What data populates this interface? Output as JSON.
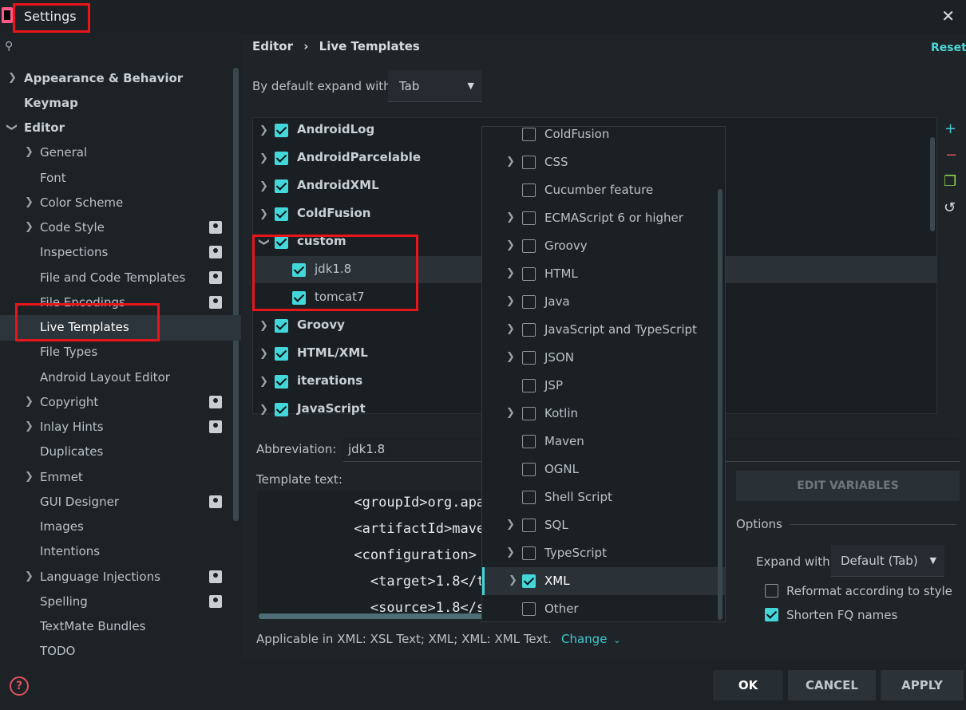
{
  "window": {
    "title": "Settings"
  },
  "sidebar": {
    "items": [
      {
        "label": "Appearance & Behavior"
      },
      {
        "label": "Keymap"
      },
      {
        "label": "Editor"
      },
      {
        "label": "General"
      },
      {
        "label": "Font"
      },
      {
        "label": "Color Scheme"
      },
      {
        "label": "Code Style"
      },
      {
        "label": "Inspections"
      },
      {
        "label": "File and Code Templates"
      },
      {
        "label": "File Encodings"
      },
      {
        "label": "Live Templates"
      },
      {
        "label": "File Types"
      },
      {
        "label": "Android Layout Editor"
      },
      {
        "label": "Copyright"
      },
      {
        "label": "Inlay Hints"
      },
      {
        "label": "Duplicates"
      },
      {
        "label": "Emmet"
      },
      {
        "label": "GUI Designer"
      },
      {
        "label": "Images"
      },
      {
        "label": "Intentions"
      },
      {
        "label": "Language Injections"
      },
      {
        "label": "Spelling"
      },
      {
        "label": "TextMate Bundles"
      },
      {
        "label": "TODO"
      }
    ]
  },
  "breadcrumb": {
    "parent": "Editor",
    "separator": "›",
    "current": "Live Templates"
  },
  "reset_label": "Reset",
  "expand_default": {
    "label": "By default expand with",
    "value": "Tab"
  },
  "template_groups": [
    {
      "label": "AndroidLog",
      "checked": true
    },
    {
      "label": "AndroidParcelable",
      "checked": true
    },
    {
      "label": "AndroidXML",
      "checked": true
    },
    {
      "label": "ColdFusion",
      "checked": true
    },
    {
      "label": "custom",
      "checked": true,
      "expanded": true
    },
    {
      "label": "jdk1.8",
      "checked": true,
      "child": true
    },
    {
      "label": "tomcat7",
      "checked": true,
      "child": true
    },
    {
      "label": "Groovy",
      "checked": true
    },
    {
      "label": "HTML/XML",
      "checked": true
    },
    {
      "label": "iterations",
      "checked": true
    },
    {
      "label": "JavaScript",
      "checked": true
    }
  ],
  "form": {
    "abbreviation_label": "Abbreviation:",
    "abbreviation_value": "jdk1.8",
    "template_text_label": "Template text:",
    "code_lines": [
      "      <groupId>org.apa",
      "      <artifactId>mave",
      "      <configuration>",
      "        <target>1.8</t",
      "        <source>1.8</s"
    ],
    "edit_variables": "EDIT VARIABLES",
    "options_label": "Options",
    "expand_with_label": "Expand with",
    "expand_with_value": "Default (Tab)",
    "reformat_label": "Reformat according to style",
    "reformat_checked": false,
    "shorten_label": "Shorten FQ names",
    "shorten_checked": true,
    "applicable_text": "Applicable in XML: XSL Text; XML; XML: XML Text.",
    "change_label": "Change"
  },
  "context_dropdown": [
    {
      "label": "ColdFusion",
      "has_children": false,
      "checked": false
    },
    {
      "label": "CSS",
      "has_children": true,
      "checked": false
    },
    {
      "label": "Cucumber feature",
      "has_children": false,
      "checked": false
    },
    {
      "label": "ECMAScript 6 or higher",
      "has_children": true,
      "checked": false
    },
    {
      "label": "Groovy",
      "has_children": true,
      "checked": false
    },
    {
      "label": "HTML",
      "has_children": true,
      "checked": false
    },
    {
      "label": "Java",
      "has_children": true,
      "checked": false
    },
    {
      "label": "JavaScript and TypeScript",
      "has_children": true,
      "checked": false
    },
    {
      "label": "JSON",
      "has_children": true,
      "checked": false
    },
    {
      "label": "JSP",
      "has_children": false,
      "checked": false
    },
    {
      "label": "Kotlin",
      "has_children": true,
      "checked": false
    },
    {
      "label": "Maven",
      "has_children": false,
      "checked": false
    },
    {
      "label": "OGNL",
      "has_children": false,
      "checked": false
    },
    {
      "label": "Shell Script",
      "has_children": false,
      "checked": false
    },
    {
      "label": "SQL",
      "has_children": true,
      "checked": false
    },
    {
      "label": "TypeScript",
      "has_children": true,
      "checked": false
    },
    {
      "label": "XML",
      "has_children": true,
      "checked": true,
      "selected": true
    },
    {
      "label": "Other",
      "has_children": false,
      "checked": false
    }
  ],
  "buttons": {
    "ok": "OK",
    "cancel": "CANCEL",
    "apply": "APPLY"
  },
  "colors": {
    "accent": "#43d7d9",
    "highlight_box": "#e8161b",
    "background": "#1f2428"
  }
}
